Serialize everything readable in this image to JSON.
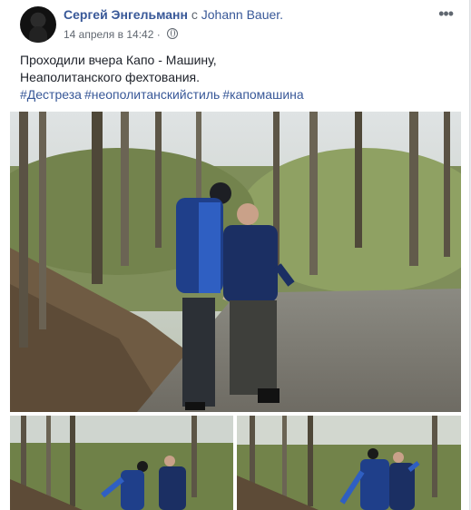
{
  "post": {
    "author": "Сергей Энгельманн",
    "with_text": "с",
    "tagged_friend": "Johann Bauer.",
    "date": "14 апреля в 14:42",
    "dot": "·",
    "more_label": "•••",
    "text_lines": [
      "Проходили вчера Капо - Машину,",
      "Неаполитанского фехтования."
    ],
    "hashtags": [
      "#Дестреза",
      "#неополитанскийстиль",
      "#капомашина"
    ]
  }
}
